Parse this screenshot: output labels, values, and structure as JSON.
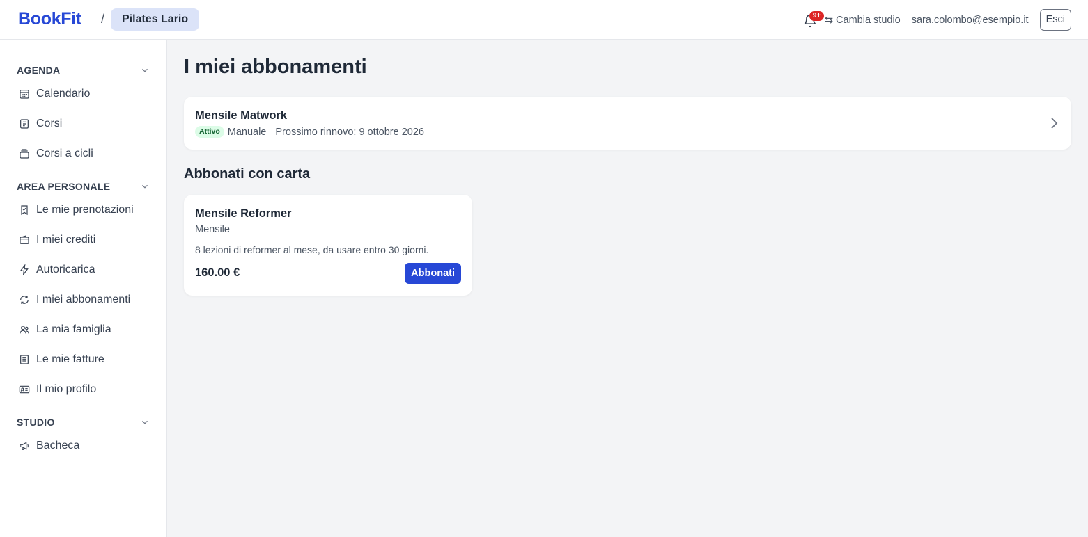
{
  "brand": {
    "logo": "BookFit",
    "separator": "/",
    "studio": "Pilates Lario",
    "accent": "#2748d6"
  },
  "header": {
    "notifications_badge": "9+",
    "switch_studio_icon": "⇆",
    "switch_studio_label": "Cambia studio",
    "user_email": "sara.colombo@esempio.it",
    "logout_label": "Esci"
  },
  "sidebar": {
    "sections": [
      {
        "title": "AGENDA",
        "items": [
          {
            "label": "Calendario",
            "icon": "calendar-icon"
          },
          {
            "label": "Corsi",
            "icon": "course-icon"
          },
          {
            "label": "Corsi a cicli",
            "icon": "cycle-courses-icon"
          }
        ]
      },
      {
        "title": "AREA PERSONALE",
        "items": [
          {
            "label": "Le mie prenotazioni",
            "icon": "bookmark-icon"
          },
          {
            "label": "I miei crediti",
            "icon": "wallet-icon"
          },
          {
            "label": "Autoricarica",
            "icon": "bolt-icon"
          },
          {
            "label": "I miei abbonamenti",
            "icon": "refresh-icon"
          },
          {
            "label": "La mia famiglia",
            "icon": "users-icon"
          },
          {
            "label": "Le mie fatture",
            "icon": "invoice-icon"
          },
          {
            "label": "Il mio profilo",
            "icon": "id-card-icon"
          }
        ]
      },
      {
        "title": "STUDIO",
        "items": [
          {
            "label": "Bacheca",
            "icon": "megaphone-icon"
          }
        ]
      }
    ]
  },
  "main": {
    "title": "I miei abbonamenti",
    "subscription": {
      "name": "Mensile Matwork",
      "status": "Attivo",
      "status_color": "#dcfce7",
      "mode": "Manuale",
      "renewal": "Prossimo rinnovo: 9 ottobre 2026"
    },
    "card_section_title": "Abbonati con carta",
    "plan": {
      "name": "Mensile Reformer",
      "period": "Mensile",
      "description": "8 lezioni di reformer al mese, da usare entro 30 giorni.",
      "price": "160.00 €",
      "cta": "Abbonati"
    }
  }
}
